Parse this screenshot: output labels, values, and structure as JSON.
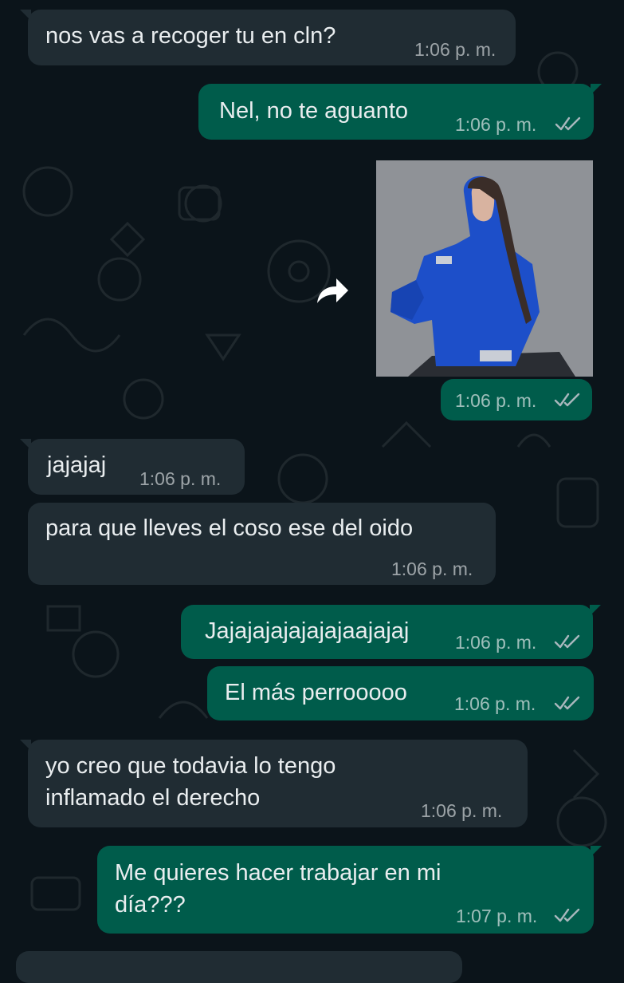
{
  "messages": [
    {
      "direction": "in",
      "text": "nos vas a recoger tu en cln?",
      "time": "1:06 p. m."
    },
    {
      "direction": "out",
      "text": "Nel, no te aguanto",
      "time": "1:06 p. m.",
      "status": "read"
    },
    {
      "direction": "out",
      "type": "image",
      "time": "1:06 p. m.",
      "status": "read"
    },
    {
      "direction": "in",
      "text": "jajajaj",
      "time": "1:06 p. m."
    },
    {
      "direction": "in",
      "text": "para que lleves el coso ese del oido",
      "time": "1:06 p. m."
    },
    {
      "direction": "out",
      "text": "Jajajajajajajajaajajaj",
      "time": "1:06 p. m.",
      "status": "read"
    },
    {
      "direction": "out",
      "text": "El más perrooooo",
      "time": "1:06 p. m.",
      "status": "read"
    },
    {
      "direction": "in",
      "text_lines": [
        "yo creo que todavia lo tengo",
        "inflamado el derecho"
      ],
      "time": "1:06 p. m."
    },
    {
      "direction": "out",
      "text_lines": [
        "Me quieres hacer trabajar en mi",
        "día???"
      ],
      "time": "1:07 p. m.",
      "status": "read"
    }
  ],
  "icons": {
    "forward": "forward-icon",
    "read_receipt": "double-check-icon"
  },
  "colors": {
    "background": "#0b141a",
    "incoming": "#202c33",
    "outgoing": "#005c4b",
    "text": "#e9edef",
    "tick": "#a8b7bd"
  }
}
